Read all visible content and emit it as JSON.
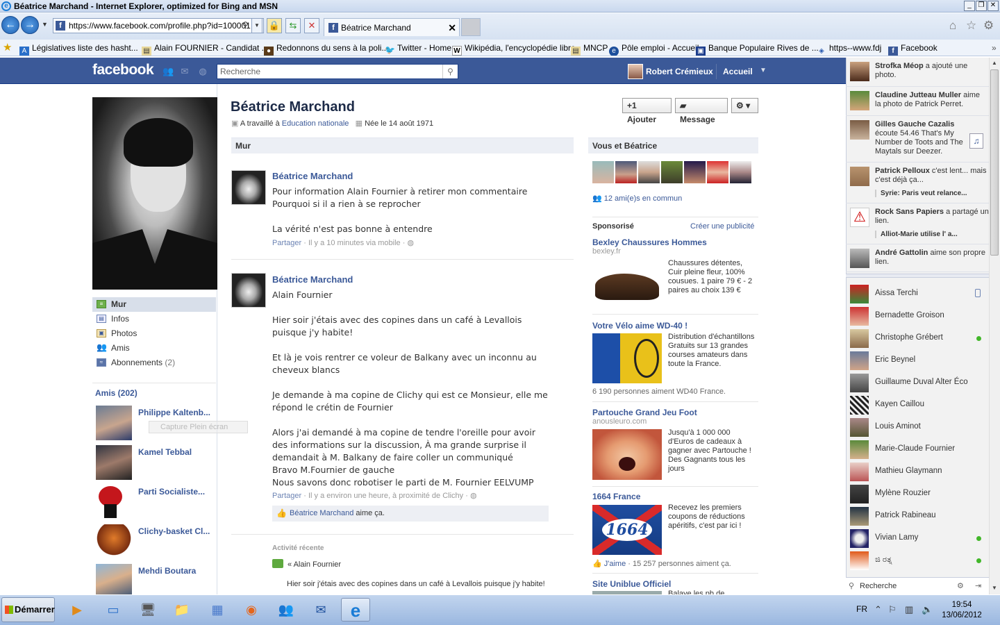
{
  "window": {
    "title": "Béatrice Marchand - Internet Explorer, optimized for Bing and MSN",
    "url": "https://www.facebook.com/profile.php?id=100001",
    "tab_label": "Béatrice Marchand"
  },
  "favorites": [
    {
      "label": "Législatives  liste des hasht...",
      "icon": "site-icon"
    },
    {
      "label": "Alain FOURNIER - Candidat ...",
      "icon": "page-icon"
    },
    {
      "label": "Redonnons du sens à la poli...",
      "icon": "site-icon"
    },
    {
      "label": "Twitter - Home",
      "icon": "twitter-icon"
    },
    {
      "label": "Wikipédia, l'encyclopédie libre",
      "icon": "wikipedia-icon"
    },
    {
      "label": "MNCP",
      "icon": "page-icon"
    },
    {
      "label": "Pôle emploi - Accueil",
      "icon": "site-icon"
    },
    {
      "label": "Banque Populaire Rives de ...",
      "icon": "bank-icon"
    },
    {
      "label": "https--www.fdj",
      "icon": "site-icon"
    },
    {
      "label": "Facebook",
      "icon": "facebook-icon"
    }
  ],
  "fb_header": {
    "logo": "facebook",
    "search_placeholder": "Recherche",
    "user_name": "Robert Crémieux",
    "home": "Accueil"
  },
  "profile": {
    "name": "Béatrice Marchand",
    "worked_prefix": "A travaillé à ",
    "worked_at": "Education nationale",
    "born": "Née le 14 août 1971",
    "btn_add": "Ajouter",
    "btn_message": "Message"
  },
  "left_nav": [
    {
      "label": "Mur",
      "icon": "wall-icon"
    },
    {
      "label": "Infos",
      "icon": "info-icon"
    },
    {
      "label": "Photos",
      "icon": "photos-icon"
    },
    {
      "label": "Amis",
      "icon": "friends-icon"
    },
    {
      "label": "Abonnements",
      "count": "(2)",
      "icon": "subscriptions-icon"
    }
  ],
  "friends": {
    "heading": "Amis (202)",
    "items": [
      "Philippe Kaltenb...",
      "Kamel Tebbal",
      "Parti Socialiste...",
      "Clichy-basket Cl...",
      "Mehdi Boutara"
    ],
    "capture_overlay": "Capture Plein écran"
  },
  "wall": {
    "heading": "Mur",
    "posts": [
      {
        "author": "Béatrice Marchand",
        "text": "Pour information Alain Fournier à retirer mon commentaire\nPourquoi si il a rien à se reprocher\n\nLa vérité n'est pas bonne à entendre",
        "share": "Partager",
        "meta": " · Il y a 10 minutes via mobile · "
      },
      {
        "author": "Béatrice Marchand",
        "text": "Alain Fournier\n\nHier soir j'étais avec des copines dans un café à Levallois puisque j'y habite!\n\nEt là je vois rentrer ce voleur de Balkany avec un inconnu au cheveux blancs\n\nJe demande à ma copine de Clichy qui est ce Monsieur, elle me répond le crétin de Fournier\n\nAlors j'ai demandé à ma copine de tendre l'oreille pour avoir des informations sur la discussion, À ma grande surprise il demandait à M. Balkany de faire coller un communiqué\nBravo M.Fournier de gauche\nNous savons donc robotiser le parti de M. Fournier EELVUMP",
        "share": "Partager",
        "meta": " · Il y a environ une heure, à proximité de Clichy · ",
        "like_name": "Béatrice Marchand",
        "like_suffix": " aime ça."
      }
    ],
    "recent_label": "Activité récente",
    "recent_item": "« Alain Fournier",
    "recent_sub": "Hier soir j'étais avec des copines dans un café à Levallois puisque j'y habite!"
  },
  "sidebar": {
    "you_and": "Vous et Béatrice",
    "mutual": "12 ami(e)s en commun",
    "sponsored": "Sponsorisé",
    "create_ad": "Créer une publicité",
    "ads": [
      {
        "title": "Bexley Chaussures Hommes",
        "url": "bexley.fr",
        "text": "Chaussures détentes, Cuir pleine fleur, 100% cousues. 1 paire 79 € - 2 paires au choix 139 €"
      },
      {
        "title": "Votre Vélo aime WD-40 !",
        "text": "Distribution d'échantillons Gratuits sur 13 grandes courses amateurs dans toute la France.",
        "likes": "6 190 personnes aiment WD40 France."
      },
      {
        "title": "Partouche Grand Jeu Foot",
        "url": "anousleuro.com",
        "text": "Jusqu'à 1 000 000 d'Euros de cadeaux à gagner avec Partouche ! Des Gagnants tous les jours"
      },
      {
        "title": "1664 France",
        "text": "Recevez les premiers coupons de réductions apéritifs, c'est par ici !",
        "like_label": "J'aime",
        "likes": " · 15 257 personnes aiment ça.",
        "img_text": "1664"
      },
      {
        "title": "Site Uniblue Officiel",
        "text": "Balaye les pb de"
      }
    ]
  },
  "ticker": [
    {
      "name": "Strofka Méop",
      "text": " a ajouté une photo."
    },
    {
      "name": "Claudine Jutteau Muller",
      "text": " aime la photo de Patrick Perret."
    },
    {
      "name": "Gilles Gauche Cazalis",
      "text": " écoute 54.46 That's My Number de Toots and The Maytals sur Deezer."
    },
    {
      "name": "Patrick Pelloux",
      "text": " c'est lent... mais c'est déjà ça...",
      "sub": "Syrie: Paris veut relance..."
    },
    {
      "name": "Rock Sans Papiers",
      "text": " a partagé un lien.",
      "sub": "Alliot-Marie utilise l' a..."
    },
    {
      "name": "André Gattolin",
      "text": " aime son propre lien."
    }
  ],
  "chat": [
    {
      "name": "Aissa Terchi",
      "status": "mobile"
    },
    {
      "name": "Bernadette Groison",
      "status": ""
    },
    {
      "name": "Christophe Grébert",
      "status": "online"
    },
    {
      "name": "Eric Beynel",
      "status": ""
    },
    {
      "name": "Guillaume Duval Alter Éco",
      "status": ""
    },
    {
      "name": "Kayen Caillou",
      "status": ""
    },
    {
      "name": "Louis Aminot",
      "status": ""
    },
    {
      "name": "Marie-Claude Fournier",
      "status": ""
    },
    {
      "name": "Mathieu Glaymann",
      "status": ""
    },
    {
      "name": "Mylène Rouzier",
      "status": ""
    },
    {
      "name": "Patrick Rabineau",
      "status": ""
    },
    {
      "name": "Vivian Lamy",
      "status": "online"
    },
    {
      "name": "ಜಿ ರತ್ನ",
      "status": "online"
    }
  ],
  "chat_search": "Recherche",
  "taskbar": {
    "start": "Démarrer",
    "lang": "FR",
    "time": "19:54",
    "date": "13/06/2012"
  },
  "colors": {
    "fb_blue": "#3b5998",
    "link": "#3b5998",
    "online": "#42b72a"
  }
}
